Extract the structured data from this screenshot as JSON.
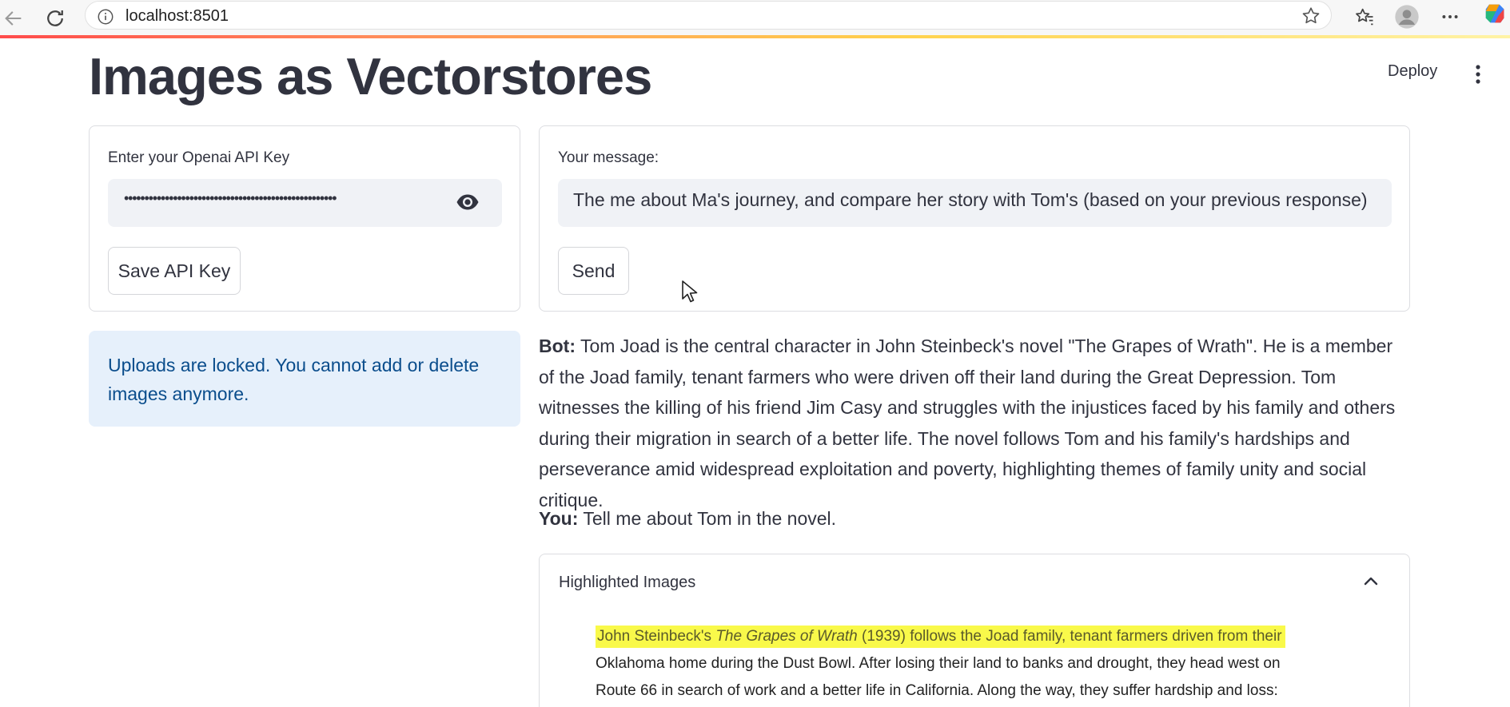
{
  "browser": {
    "url_host": "localhost",
    "url_port": ":8501"
  },
  "app": {
    "title": "Images as Vectorstores",
    "deploy_label": "Deploy"
  },
  "api_card": {
    "label": "Enter your Openai API Key",
    "masked_value": "••••••••••••••••••••••••••••••••••••••••••••••••••••",
    "save_label": "Save API Key"
  },
  "message_card": {
    "label": "Your message:",
    "value": "The me about Ma's journey, and compare her story with Tom's (based on your previous response)",
    "send_label": "Send"
  },
  "info": {
    "text": "Uploads are locked. You cannot add or delete images anymore."
  },
  "chat": [
    {
      "speaker": "Bot:",
      "text": "Tom Joad is the central character in John Steinbeck's novel \"The Grapes of Wrath\". He is a member of the Joad family, tenant farmers who were driven off their land during the Great Depression. Tom witnesses the killing of his friend Jim Casy and struggles with the injustices faced by his family and others during their migration in search of a better life. The novel follows Tom and his family's hardships and perseverance amid widespread exploitation and poverty, highlighting themes of family unity and social critique."
    },
    {
      "speaker": "You:",
      "text": "Tell me about Tom in the novel."
    }
  ],
  "expander": {
    "title": "Highlighted Images",
    "doc": {
      "line1_a": "John Steinbeck's ",
      "line1_italic": "The Grapes of Wrath",
      "line1_b": " (1939) follows the Joad family, tenant farmers driven from their",
      "line2": "Oklahoma home during the Dust Bowl. After losing their land to banks and drought, they head west on",
      "line3": "Route 66 in search of work and a better life in California. Along the way, they suffer hardship and loss:"
    }
  },
  "colors": {
    "info_bg": "#e6f0fb",
    "info_text": "#0a4d8c",
    "highlight": "#f9f94a",
    "text": "#31333f"
  }
}
